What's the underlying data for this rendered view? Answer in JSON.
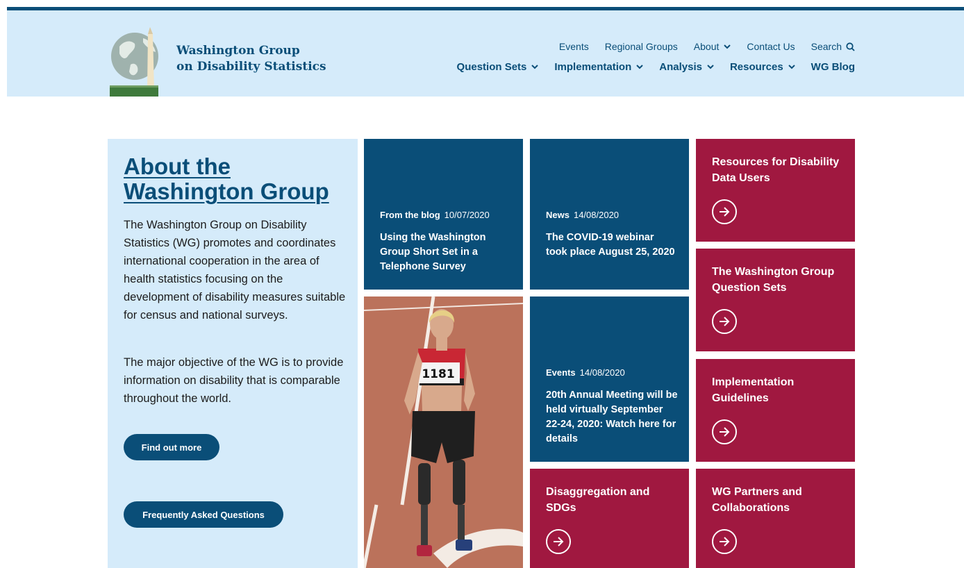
{
  "brand": {
    "line1": "Washington Group",
    "line2": "on Disability Statistics"
  },
  "utility_nav": {
    "events": "Events",
    "regional_groups": "Regional Groups",
    "about": "About",
    "contact_us": "Contact Us",
    "search": "Search"
  },
  "main_nav": {
    "question_sets": "Question Sets",
    "implementation": "Implementation",
    "analysis": "Analysis",
    "resources": "Resources",
    "wg_blog": "WG Blog"
  },
  "about": {
    "heading": "About the Washington Group",
    "para1": "The Washington Group on Disability Statistics (WG) promotes and coordinates international cooperation in the area of health statistics focusing on the development of disability measures suitable for census and national surveys.",
    "para2": "The major objective of the WG is to provide information on disability that is comparable throughout the world.",
    "find_out_more": "Find out more",
    "faq": "Frequently Asked Questions"
  },
  "news": [
    {
      "category": "From the blog",
      "date": "10/07/2020",
      "title": "Using the Washington Group Short Set in a Telephone Survey"
    },
    {
      "category": "News",
      "date": "14/08/2020",
      "title": "The COVID-19 webinar took place August 25, 2020"
    },
    {
      "category": "Events",
      "date": "14/08/2020",
      "title": "20th Annual Meeting will be held virtually September 22-24, 2020: Watch here for details"
    }
  ],
  "photo": {
    "bib_number": "1181"
  },
  "links": [
    {
      "title": "Resources for Disability Data Users"
    },
    {
      "title": "The Washington Group Question Sets"
    },
    {
      "title": "Implementation Guidelines"
    },
    {
      "title": "WG Partners and Collaborations"
    },
    {
      "title": "Disaggregation and SDGs"
    }
  ],
  "colors": {
    "navy": "#0a4e78",
    "crimson": "#a01840",
    "light_blue": "#d5ebfa"
  },
  "icons": [
    "chevron-down-icon",
    "search-icon",
    "arrow-right-circle-icon"
  ]
}
